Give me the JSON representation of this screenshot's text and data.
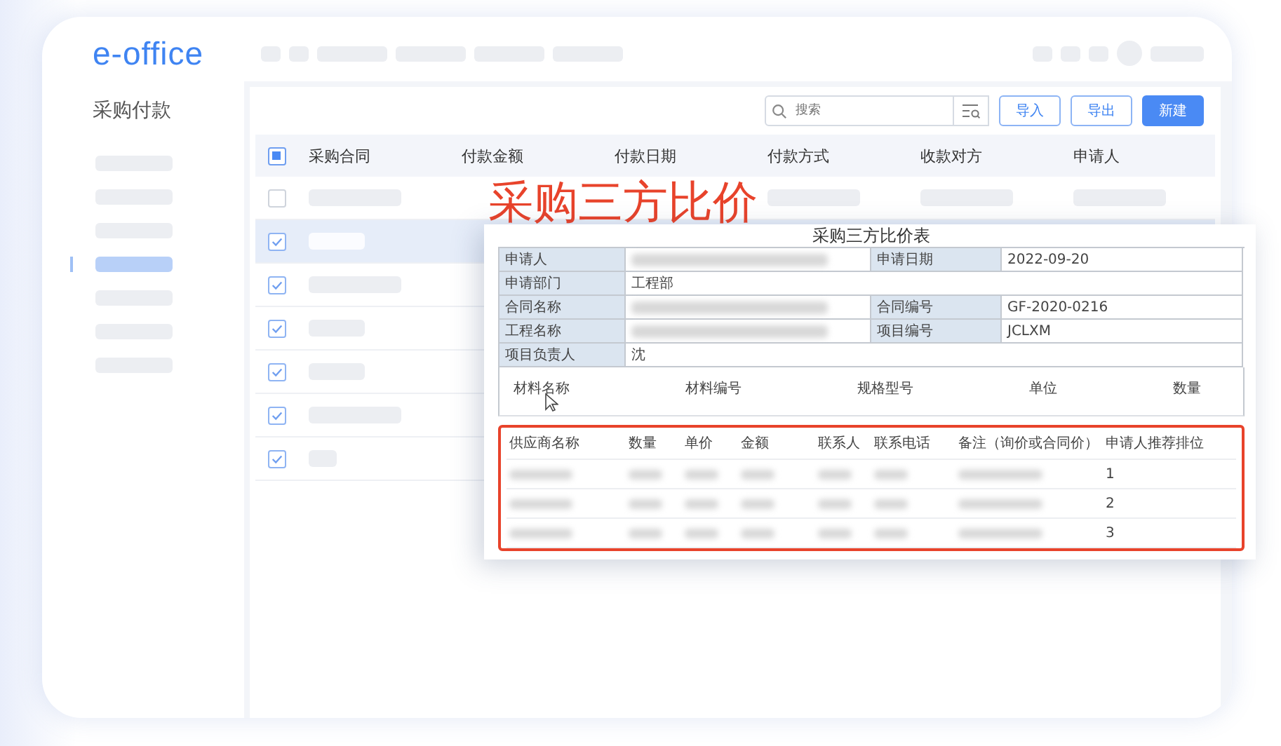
{
  "app": {
    "logo": "e-office"
  },
  "sidebar": {
    "title": "采购付款",
    "items": [
      {
        "selected": false
      },
      {
        "selected": false
      },
      {
        "selected": false
      },
      {
        "selected": true
      },
      {
        "selected": false
      },
      {
        "selected": false
      },
      {
        "selected": false
      }
    ]
  },
  "toolbar": {
    "search": {
      "placeholder": "搜索"
    },
    "buttons": [
      {
        "label": "导入",
        "kind": "outline"
      },
      {
        "label": "导出",
        "kind": "outline"
      },
      {
        "label": "新建",
        "kind": "primary"
      }
    ]
  },
  "table": {
    "header_checkbox": {
      "indeterminate": true
    },
    "columns": [
      "采购合同",
      "付款金额",
      "付款日期",
      "付款方式",
      "收款对方",
      "申请人"
    ],
    "rows": [
      {
        "checked": false,
        "selected": false
      },
      {
        "checked": true,
        "selected": true
      },
      {
        "checked": true,
        "selected": false
      },
      {
        "checked": true,
        "selected": false
      },
      {
        "checked": true,
        "selected": false
      },
      {
        "checked": true,
        "selected": false
      },
      {
        "checked": true,
        "selected": false
      }
    ]
  },
  "overlay": {
    "caption": "采购三方比价",
    "form": {
      "title": "采购三方比价表",
      "rows": [
        [
          {
            "label": "申请人",
            "redacted": true
          },
          {
            "label": "申请日期",
            "value": "2022-09-20"
          }
        ],
        [
          {
            "label": "申请部门",
            "value": "工程部"
          }
        ],
        [
          {
            "label": "合同名称",
            "redacted": true
          },
          {
            "label": "合同编号",
            "value": "GF-2020-0216"
          }
        ],
        [
          {
            "label": "工程名称",
            "redacted": true
          },
          {
            "label": "项目编号",
            "value": "JCLXM"
          }
        ],
        [
          {
            "label": "项目负责人",
            "value": "沈"
          }
        ]
      ],
      "materials": {
        "columns": [
          "材料名称",
          "材料编号",
          "规格型号",
          "单位",
          "数量"
        ]
      },
      "suppliers": {
        "highlighted": true,
        "columns": [
          "供应商名称",
          "数量",
          "单价",
          "金额",
          "联系人",
          "联系电话",
          "备注（询价或合同价）",
          "申请人推荐排位"
        ],
        "rows": [
          {
            "rank": "1"
          },
          {
            "rank": "2"
          },
          {
            "rank": "3"
          }
        ]
      }
    }
  }
}
